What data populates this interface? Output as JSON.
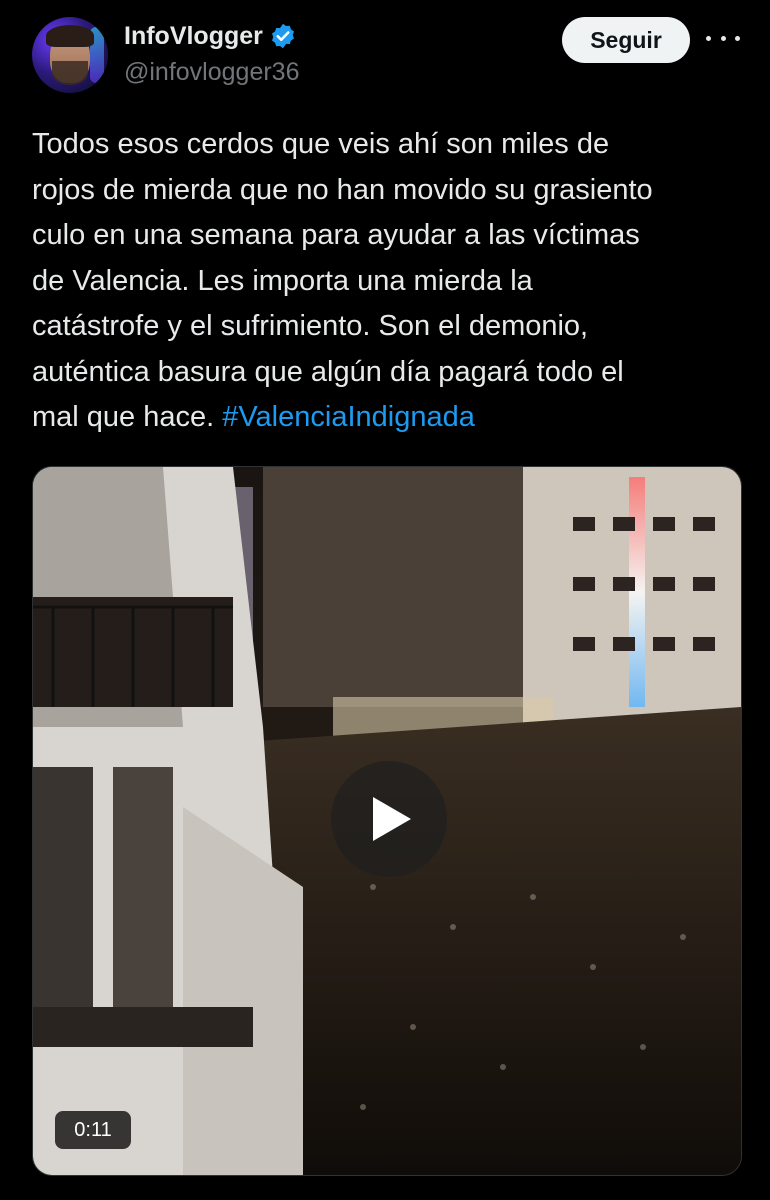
{
  "author": {
    "display_name": "InfoVlogger",
    "handle": "@infovlogger36",
    "verified": true,
    "verified_color": "#1d9bf0"
  },
  "actions": {
    "follow_label": "Seguir",
    "more_icon": "more-horizontal-icon"
  },
  "tweet": {
    "lines": [
      "Todos esos cerdos que veis ahí son miles de",
      "rojos de mierda que no han movido su grasiento",
      "culo en una semana para ayudar a las víctimas",
      "de Valencia. Les importa una mierda la",
      "catástrofe y el sufrimiento. Son el demonio,",
      "auténtica basura que algún día pagará todo el",
      "mal que hace. "
    ],
    "hashtag": "#ValenciaIndignada",
    "hashtag_color": "#1d9bf0"
  },
  "media": {
    "type": "video",
    "duration": "0:11",
    "play_icon": "play-icon"
  }
}
